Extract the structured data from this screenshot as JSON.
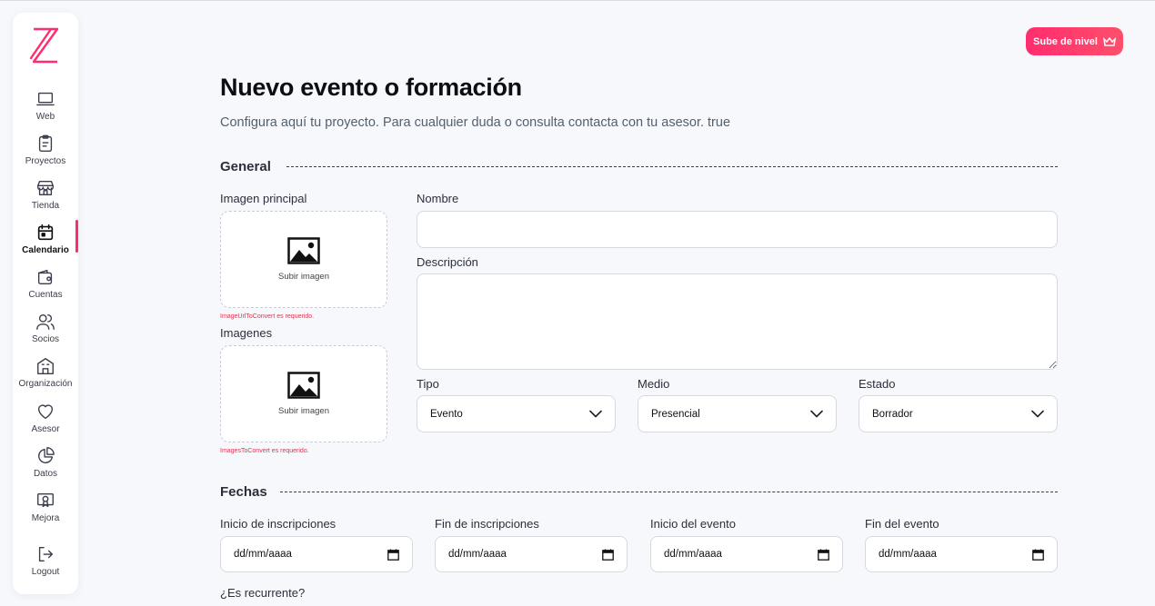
{
  "sidebar": {
    "items": [
      {
        "label": "Web",
        "icon": "laptop-icon"
      },
      {
        "label": "Proyectos",
        "icon": "clipboard-icon"
      },
      {
        "label": "Tienda",
        "icon": "store-icon"
      },
      {
        "label": "Calendario",
        "icon": "calendar-icon",
        "active": true
      },
      {
        "label": "Cuentas",
        "icon": "wallet-icon"
      },
      {
        "label": "Socios",
        "icon": "users-icon"
      },
      {
        "label": "Organización",
        "icon": "building-icon"
      },
      {
        "label": "Asesor",
        "icon": "heart-icon"
      },
      {
        "label": "Datos",
        "icon": "pie-chart-icon"
      },
      {
        "label": "Mejora",
        "icon": "certificate-icon"
      },
      {
        "label": "Logout",
        "icon": "logout-icon"
      }
    ]
  },
  "header": {
    "upgrade_label": "Sube de nivel",
    "title": "Nuevo evento o formación",
    "subtitle": "Configura aquí tu proyecto. Para cualquier duda o consulta contacta con tu asesor. true"
  },
  "general": {
    "section_title": "General",
    "main_image_label": "Imagen principal",
    "main_image_upload": "Subir imagen",
    "main_image_error": "ImageUrlToConvert es requerido.",
    "images_label": "Imagenes",
    "images_upload": "Subir imagen",
    "images_error": "ImagesToConvert es requerido.",
    "name_label": "Nombre",
    "name_value": "",
    "description_label": "Descripción",
    "description_value": "",
    "type_label": "Tipo",
    "type_value": "Evento",
    "medium_label": "Medio",
    "medium_value": "Presencial",
    "status_label": "Estado",
    "status_value": "Borrador"
  },
  "dates": {
    "section_title": "Fechas",
    "fields": [
      {
        "label": "Inicio de inscripciones",
        "placeholder": "dd/mm/aaaa"
      },
      {
        "label": "Fin de inscripciones",
        "placeholder": "dd/mm/aaaa"
      },
      {
        "label": "Inicio del evento",
        "placeholder": "dd/mm/aaaa"
      },
      {
        "label": "Fin del evento",
        "placeholder": "dd/mm/aaaa"
      }
    ],
    "recurring_label": "¿Es recurrente?"
  },
  "colors": {
    "accent": "#ff2d6f",
    "error": "#e0344f",
    "background": "#f6f8fc"
  }
}
